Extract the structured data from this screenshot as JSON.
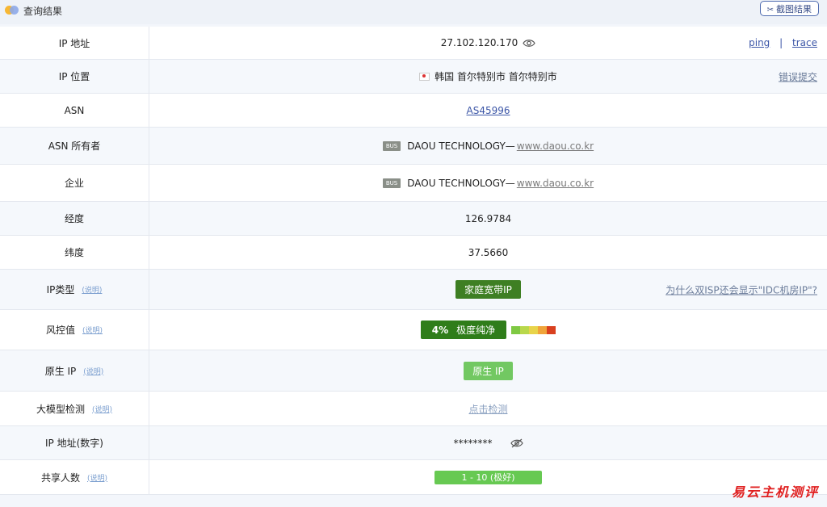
{
  "header": {
    "title": "查询结果",
    "screenshot_button": "截图结果",
    "screenshot_icon": "scissors-icon"
  },
  "rows": {
    "ip": {
      "label": "IP 地址",
      "value": "27.102.120.170",
      "ping": "ping",
      "sep": "|",
      "trace": "trace"
    },
    "location": {
      "label": "IP 位置",
      "value": "韩国 首尔特别市 首尔特别市",
      "report": "错误提交"
    },
    "asn": {
      "label": "ASN",
      "value": "AS45996"
    },
    "asn_owner": {
      "label": "ASN 所有者",
      "tag": "BUS",
      "name": "DAOU TECHNOLOGY—",
      "site": "www.daou.co.kr"
    },
    "company": {
      "label": "企业",
      "tag": "BUS",
      "name": "DAOU TECHNOLOGY—",
      "site": "www.daou.co.kr"
    },
    "longitude": {
      "label": "经度",
      "value": "126.9784"
    },
    "latitude": {
      "label": "纬度",
      "value": "37.5660"
    },
    "ip_type": {
      "label": "IP类型",
      "help": "(说明)",
      "value": "家庭宽带IP",
      "question": "为什么双ISP还会显示\"IDC机房IP\"?"
    },
    "risk": {
      "label": "风控值",
      "help": "(说明)",
      "percent": "4%",
      "text": "极度纯净",
      "bar_colors": [
        "#7fc943",
        "#b9d84b",
        "#e8d44a",
        "#f0a43a",
        "#d9401f"
      ]
    },
    "native": {
      "label": "原生 IP",
      "help": "(说明)",
      "value": "原生 IP"
    },
    "llm": {
      "label": "大模型检测",
      "help": "(说明)",
      "value": "点击检测"
    },
    "ip_numeric": {
      "label": "IP 地址(数字)",
      "value": "********"
    },
    "share": {
      "label": "共享人数",
      "help": "(说明)",
      "value": "1 - 10 (极好)"
    }
  },
  "watermark": "易云主机测评"
}
